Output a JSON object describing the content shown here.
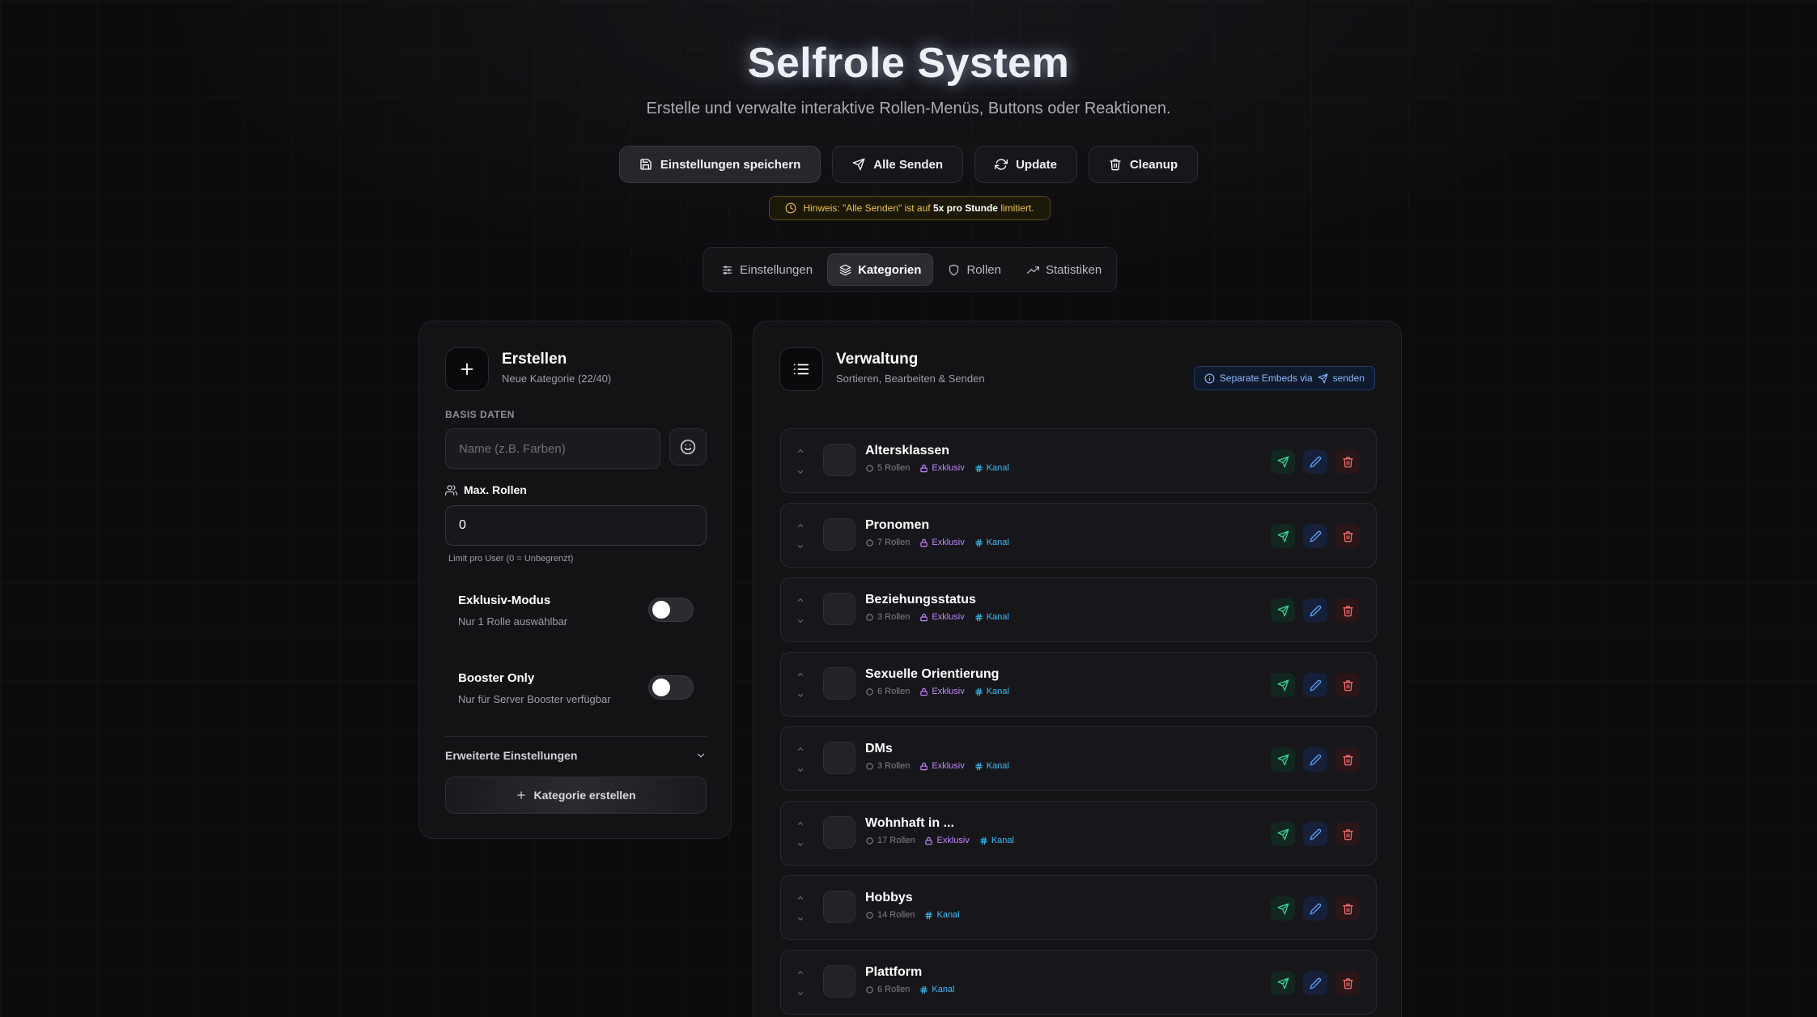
{
  "header": {
    "title": "Selfrole System",
    "subtitle": "Erstelle und verwalte interaktive Rollen-Menüs, Buttons oder Reaktionen."
  },
  "actions": {
    "save": "Einstellungen speichern",
    "send_all": "Alle Senden",
    "update": "Update",
    "cleanup": "Cleanup"
  },
  "notice": {
    "prefix": "Hinweis: \"Alle Senden\" ist auf",
    "strong": "5x pro Stunde",
    "suffix": "limitiert."
  },
  "tabs": [
    {
      "label": "Einstellungen",
      "icon": "sliders-icon"
    },
    {
      "label": "Kategorien",
      "icon": "layers-icon",
      "active": true
    },
    {
      "label": "Rollen",
      "icon": "shield-icon"
    },
    {
      "label": "Statistiken",
      "icon": "trending-up-icon"
    }
  ],
  "create_panel": {
    "title": "Erstellen",
    "subtitle": "Neue Kategorie (22/40)",
    "section_label": "BASIS DATEN",
    "name_placeholder": "Name (z.B. Farben)",
    "max_label": "Max. Rollen",
    "max_value": "0",
    "max_hint": "Limit pro User (0 = Unbegrenzt)",
    "exclusive_title": "Exklusiv-Modus",
    "exclusive_desc": "Nur 1 Rolle auswählbar",
    "booster_title": "Booster Only",
    "booster_desc": "Nur für Server Booster verfügbar",
    "advanced": "Erweiterte Einstellungen",
    "create_button": "Kategorie erstellen"
  },
  "manage_panel": {
    "title": "Verwaltung",
    "subtitle": "Sortieren, Bearbeiten & Senden",
    "badge_prefix": "Separate Embeds via",
    "badge_suffix": "senden",
    "categories": [
      {
        "name": "Altersklassen",
        "roles": "5 Rollen",
        "exclusive": "Exklusiv",
        "channel": "Kanal"
      },
      {
        "name": "Pronomen",
        "roles": "7 Rollen",
        "exclusive": "Exklusiv",
        "channel": "Kanal"
      },
      {
        "name": "Beziehungsstatus",
        "roles": "3 Rollen",
        "exclusive": "Exklusiv",
        "channel": "Kanal"
      },
      {
        "name": "Sexuelle Orientierung",
        "roles": "6 Rollen",
        "exclusive": "Exklusiv",
        "channel": "Kanal"
      },
      {
        "name": "DMs",
        "roles": "3 Rollen",
        "exclusive": "Exklusiv",
        "channel": "Kanal"
      },
      {
        "name": "Wohnhaft in ...",
        "roles": "17 Rollen",
        "exclusive": "Exklusiv",
        "channel": "Kanal"
      },
      {
        "name": "Hobbys",
        "roles": "14 Rollen",
        "exclusive": null,
        "channel": "Kanal"
      },
      {
        "name": "Plattform",
        "roles": "6 Rollen",
        "exclusive": null,
        "channel": "Kanal"
      }
    ]
  },
  "colors": {
    "accent_purple": "#c084fc",
    "accent_cyan": "#38bdf8",
    "send_green": "#34d399",
    "edit_blue": "#60a5fa",
    "delete_red": "#f87171",
    "notice_amber": "#e9c24e"
  }
}
